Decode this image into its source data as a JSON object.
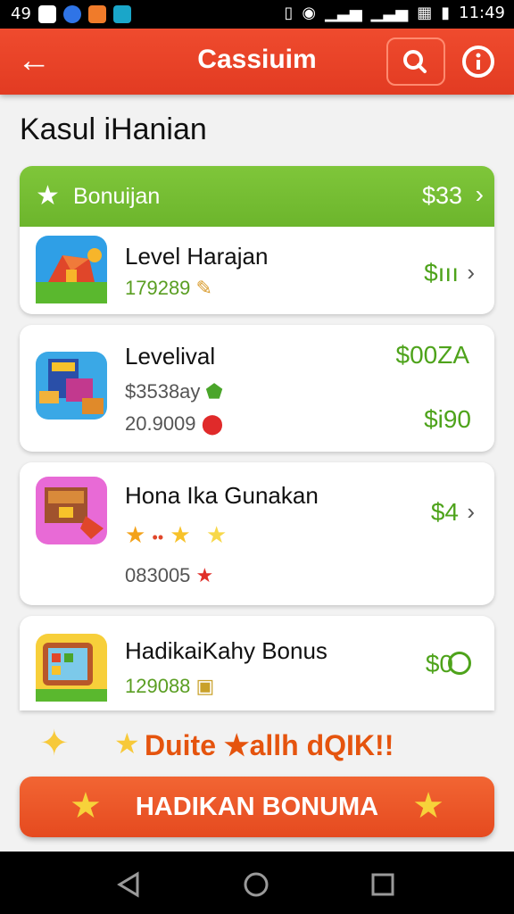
{
  "status_bar": {
    "left_text": "49",
    "time": "11:49"
  },
  "app_bar": {
    "title": "Cassiuim"
  },
  "page_title": "Kasul iHanian",
  "bonus_card": {
    "label": "Bonuijan",
    "amount": "$33"
  },
  "items": [
    {
      "title": "Level Harajan",
      "sub1": "179289",
      "price": "$ııı"
    },
    {
      "title": "Levelival",
      "price_top": "$00ZA",
      "sub1": "$3538ay",
      "sub2": "20.9009",
      "price": "$i90"
    },
    {
      "title": "Hona Ika Gunakan",
      "price": "$4",
      "sub2": "083005"
    },
    {
      "title": "HadikaiKahy Bonus",
      "sub1": "129088",
      "price": "$0"
    }
  ],
  "promo_text": "Duite ★allh dQIK!!",
  "cta": {
    "label": "HADIKAN BONUMA"
  },
  "colors": {
    "accent": "#e64226",
    "green": "#74bb32",
    "price_green": "#4ea31b",
    "promo_orange": "#e5540e"
  }
}
